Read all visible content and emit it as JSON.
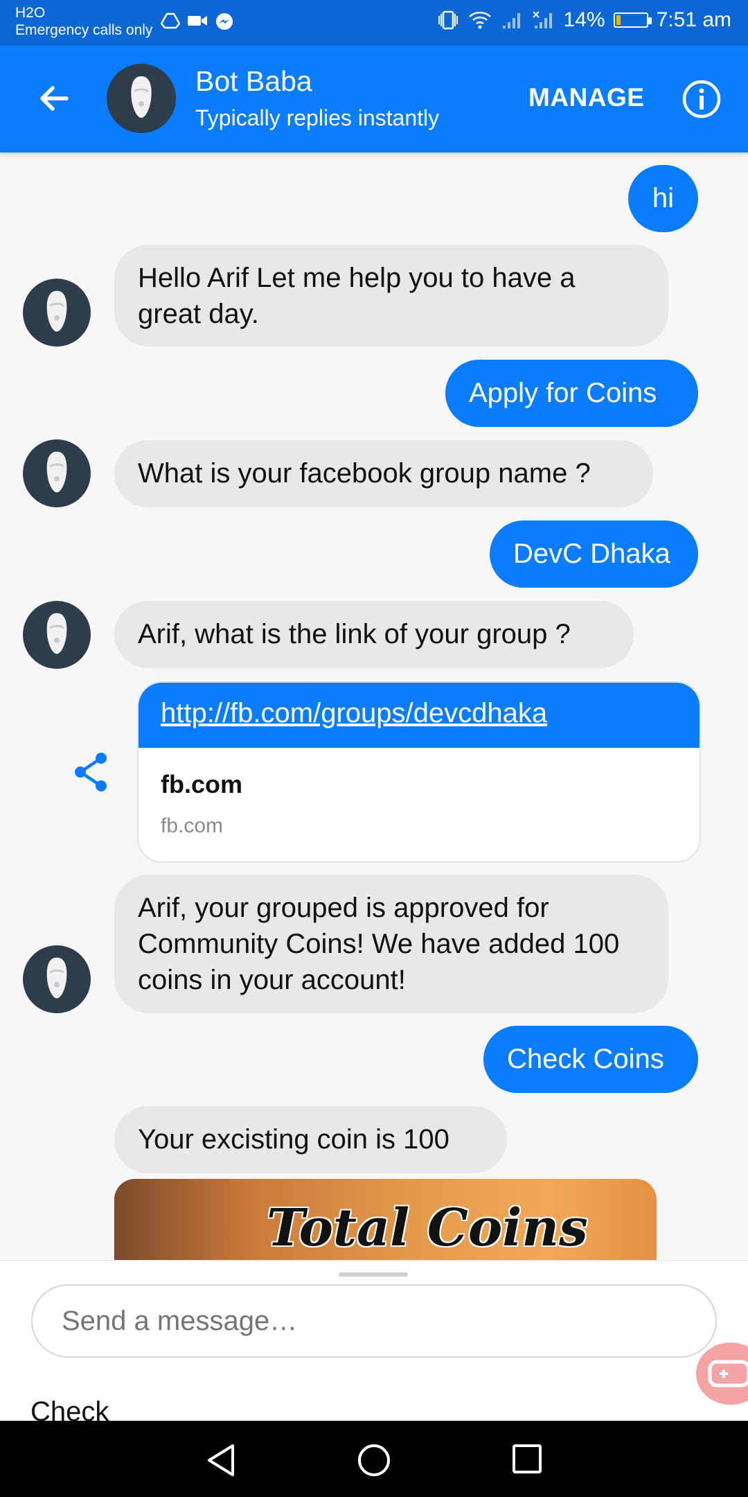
{
  "status_bar": {
    "carrier": "H2O",
    "network_note": "Emergency calls only",
    "battery": "14%",
    "battery_level": 0.14,
    "time": "7:51 am",
    "icons": [
      "drive-icon",
      "video-icon",
      "messenger-icon",
      "vibrate-icon",
      "wifi-icon",
      "signal-icon",
      "signal-x-icon",
      "battery-icon"
    ]
  },
  "header": {
    "title": "Bot Baba",
    "subtitle": "Typically replies instantly",
    "manage_label": "MANAGE",
    "back_icon": "arrow-left-icon",
    "info_icon": "info-icon",
    "accent": "#0a7cff"
  },
  "messages": [
    {
      "from": "user",
      "text": "hi"
    },
    {
      "from": "bot",
      "text": "Hello Arif Let me help you to have a great day."
    },
    {
      "from": "user",
      "text": "Apply for Coins"
    },
    {
      "from": "bot",
      "text": "What is your facebook group name ?"
    },
    {
      "from": "user",
      "text": "DevC Dhaka"
    },
    {
      "from": "bot",
      "text": "Arif, what is the link of your group ?"
    },
    {
      "from": "bot",
      "text": "Arif, your grouped is approved for Community Coins! We have added 100 coins in your account!"
    },
    {
      "from": "user",
      "text": "Check Coins"
    },
    {
      "from": "bot",
      "text": "Your excisting coin is 100"
    }
  ],
  "link_card": {
    "url": "http://fb.com/groups/devcdhaka",
    "title": "fb.com",
    "domain": "fb.com"
  },
  "image_card": {
    "caption": "Total Coins"
  },
  "composer": {
    "placeholder": "Send a message…",
    "quick_reply": "Check"
  }
}
